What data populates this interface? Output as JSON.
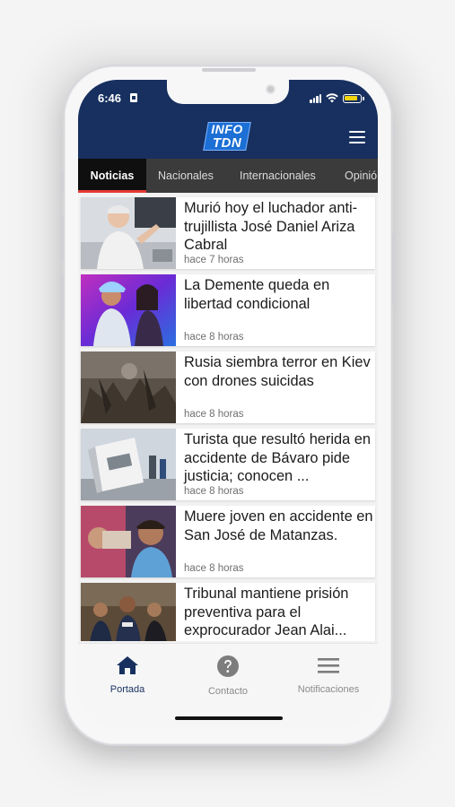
{
  "status_bar": {
    "time": "6:46"
  },
  "header": {
    "logo_top": "INFO",
    "logo_bottom": "TDN",
    "menu_icon": "hamburger-menu-icon"
  },
  "tabs": [
    {
      "label": "Noticias",
      "active": true
    },
    {
      "label": "Nacionales",
      "active": false
    },
    {
      "label": "Internacionales",
      "active": false
    },
    {
      "label": "Opinión",
      "active": false
    }
  ],
  "articles": [
    {
      "title": "Murió hoy el luchador anti-trujillista José Daniel Ariza Cabral",
      "time": "hace 7 horas"
    },
    {
      "title": "La Demente queda en libertad condicional",
      "time": "hace 8 horas"
    },
    {
      "title": "Rusia siembra terror en Kiev con drones suicidas",
      "time": "hace 8 horas"
    },
    {
      "title": "Turista que resultó herida en accidente de Bávaro pide justicia; conocen ...",
      "time": "hace 8 horas"
    },
    {
      "title": "Muere joven en accidente en San José de Matanzas.",
      "time": "hace 8 horas"
    },
    {
      "title": "Tribunal mantiene prisión preventiva para el exprocurador Jean Alai...",
      "time": ""
    }
  ],
  "bottom_nav": [
    {
      "label": "Portada",
      "icon": "home-icon",
      "active": true
    },
    {
      "label": "Contacto",
      "icon": "help-circle-icon",
      "active": false
    },
    {
      "label": "Notificaciones",
      "icon": "list-icon",
      "active": false
    }
  ],
  "colors": {
    "header_bg": "#17305f",
    "tab_bar_bg": "#3b3b3b",
    "active_tab_bg": "#0f0f10",
    "active_tab_indicator": "#e53935",
    "nav_active": "#17305f",
    "nav_inactive": "#8a8a8a"
  }
}
